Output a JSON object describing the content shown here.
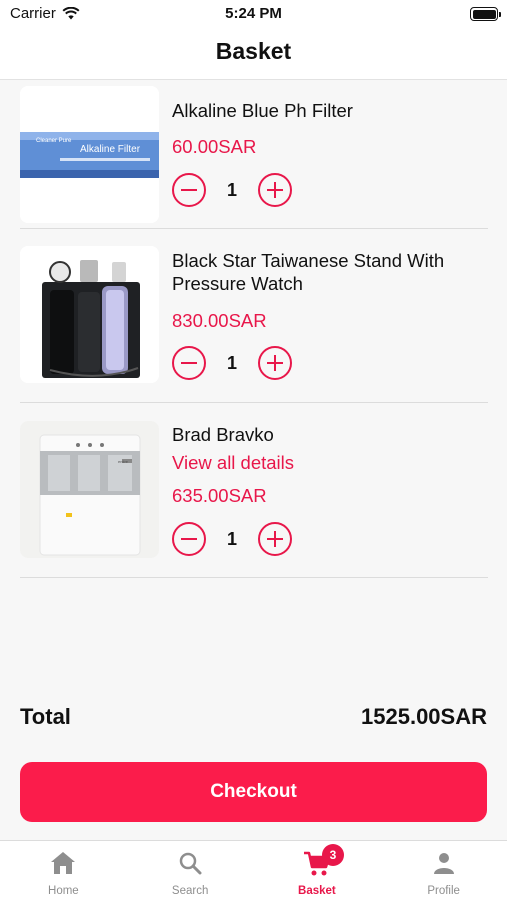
{
  "status_bar": {
    "carrier": "Carrier",
    "time": "5:24 PM"
  },
  "header": {
    "title": "Basket"
  },
  "items": [
    {
      "name": "Alkaline Blue Ph Filter",
      "price": "60.00SAR",
      "quantity": "1"
    },
    {
      "name": "Black Star Taiwanese Stand With Pressure Watch",
      "price": "830.00SAR",
      "quantity": "1"
    },
    {
      "name": "Brad Bravko",
      "link": "View all details",
      "price": "635.00SAR",
      "quantity": "1"
    }
  ],
  "thumbnail_text": {
    "filter_brand": "Cleaner Pure",
    "filter_label": "Alkaline Filter",
    "dispenser_logo": "entire"
  },
  "summary": {
    "total_label": "Total",
    "total_value": "1525.00SAR"
  },
  "checkout": {
    "label": "Checkout"
  },
  "tabs": [
    {
      "label": "Home",
      "icon": "home-icon"
    },
    {
      "label": "Search",
      "icon": "search-icon"
    },
    {
      "label": "Basket",
      "icon": "cart-icon",
      "badge": "3"
    },
    {
      "label": "Profile",
      "icon": "person-icon"
    }
  ],
  "colors": {
    "accent": "#e8174a",
    "checkout_bg": "#fb1c4b",
    "tab_inactive": "#8e8e8e"
  }
}
